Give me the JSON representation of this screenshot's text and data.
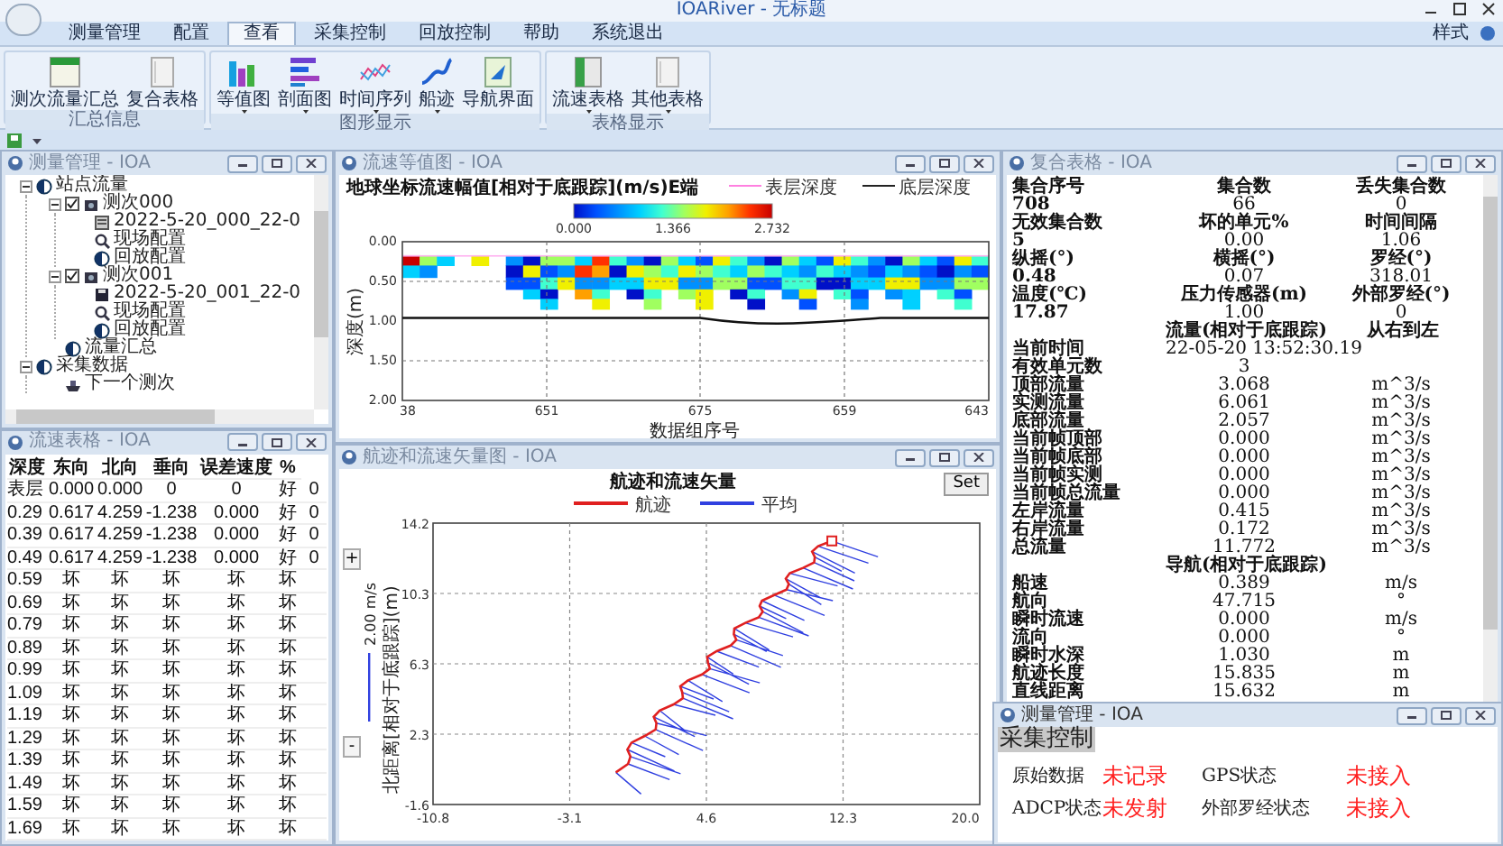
{
  "window": {
    "title": "IOARiver - 无标题"
  },
  "menu_tabs": [
    {
      "label": "测量管理",
      "selected": false
    },
    {
      "label": "配置",
      "selected": false
    },
    {
      "label": "查看",
      "selected": true
    },
    {
      "label": "采集控制",
      "selected": false
    },
    {
      "label": "回放控制",
      "selected": false
    },
    {
      "label": "帮助",
      "selected": false
    },
    {
      "label": "系统退出",
      "selected": false
    }
  ],
  "style_menu": "样式",
  "ribbon_groups": [
    {
      "label": "汇总信息",
      "buttons": [
        {
          "label": "测次流量汇总",
          "kind": "summary",
          "dropdown": false
        },
        {
          "label": "复合表格",
          "kind": "page",
          "dropdown": false
        }
      ]
    },
    {
      "label": "图形显示",
      "buttons": [
        {
          "label": "等值图",
          "kind": "bars",
          "dropdown": true
        },
        {
          "label": "剖面图",
          "kind": "hbars",
          "dropdown": true
        },
        {
          "label": "时间序列",
          "kind": "series",
          "dropdown": true
        },
        {
          "label": "船迹",
          "kind": "track",
          "dropdown": true
        },
        {
          "label": "导航界面",
          "kind": "nav",
          "dropdown": false
        }
      ]
    },
    {
      "label": "表格显示",
      "buttons": [
        {
          "label": "流速表格",
          "kind": "table",
          "dropdown": true
        },
        {
          "label": "其他表格",
          "kind": "page",
          "dropdown": true
        }
      ]
    }
  ],
  "tree_panel": {
    "title": "测量管理 - IOA",
    "nodes": [
      {
        "label": "站点流量",
        "kind": "site",
        "expanded": true,
        "children": [
          {
            "label": "测次000",
            "kind": "run",
            "checked": true,
            "expanded": true,
            "children": [
              {
                "label": "2022-5-20_000_22-0",
                "kind": "file"
              },
              {
                "label": "现场配置",
                "kind": "config"
              },
              {
                "label": "回放配置",
                "kind": "site"
              }
            ]
          },
          {
            "label": "测次001",
            "kind": "run",
            "checked": true,
            "expanded": true,
            "children": [
              {
                "label": "2022-5-20_001_22-0",
                "kind": "disk"
              },
              {
                "label": "现场配置",
                "kind": "config"
              },
              {
                "label": "回放配置",
                "kind": "site"
              }
            ]
          },
          {
            "label": "流量汇总",
            "kind": "site"
          }
        ]
      },
      {
        "label": "采集数据",
        "kind": "site",
        "expanded": true,
        "children": [
          {
            "label": "下一个测次",
            "kind": "boat"
          }
        ]
      }
    ]
  },
  "contour_panel": {
    "title": "流速等值图 - IOA",
    "chart_title": "地球坐标流速幅值[相对于底跟踪](m/s)E端",
    "legend": [
      "表层深度",
      "底层深度"
    ],
    "colorbar_labels": [
      "0.000",
      "1.366",
      "2.732"
    ],
    "yticks": [
      "0.00",
      "0.50",
      "1.00",
      "1.50",
      "2.00"
    ],
    "ylabel": "深度(m)",
    "xticks": [
      "38",
      "651",
      "675",
      "659",
      "643"
    ],
    "xlabel": "数据组序号"
  },
  "composite_panel": {
    "title": "复合表格 - IOA",
    "rows": [
      {
        "kind": "label",
        "name": "集合序号",
        "value": "集合数",
        "unit": "丢失集合数"
      },
      {
        "kind": "value",
        "name": "708",
        "value": "66",
        "unit": "0"
      },
      {
        "kind": "label",
        "name": "无效集合数",
        "value": "坏的单元%",
        "unit": "时间间隔"
      },
      {
        "kind": "value",
        "name": "5",
        "value": "0.00",
        "unit": "1.06"
      },
      {
        "kind": "label",
        "name": "纵摇(°)",
        "value": "横摇(°)",
        "unit": "罗经(°)"
      },
      {
        "kind": "value",
        "name": "0.48",
        "value": "0.07",
        "unit": "318.01"
      },
      {
        "kind": "label",
        "name": "温度(℃)",
        "value": "压力传感器(m)",
        "unit": "外部罗经(°)"
      },
      {
        "kind": "value",
        "name": "17.87",
        "value": "1.00",
        "unit": "0"
      },
      {
        "kind": "label",
        "value": "流量(相对于底跟踪)",
        "unit": "从右到左"
      },
      {
        "kind": "value",
        "name": "当前时间",
        "value": "22-05-20 13:52:30.19"
      },
      {
        "kind": "value",
        "name": "有效单元数",
        "value": "3"
      },
      {
        "kind": "value",
        "name": "顶部流量",
        "value": "3.068",
        "unit": "m^3/s"
      },
      {
        "kind": "value",
        "name": "实测流量",
        "value": "6.061",
        "unit": "m^3/s"
      },
      {
        "kind": "value",
        "name": "底部流量",
        "value": "2.057",
        "unit": "m^3/s"
      },
      {
        "kind": "value",
        "name": "当前帧顶部",
        "value": "0.000",
        "unit": "m^3/s"
      },
      {
        "kind": "value",
        "name": "当前帧底部",
        "value": "0.000",
        "unit": "m^3/s"
      },
      {
        "kind": "value",
        "name": "当前帧实测",
        "value": "0.000",
        "unit": "m^3/s"
      },
      {
        "kind": "value",
        "name": "当前帧总流量",
        "value": "0.000",
        "unit": "m^3/s"
      },
      {
        "kind": "value",
        "name": "左岸流量",
        "value": "0.415",
        "unit": "m^3/s"
      },
      {
        "kind": "value",
        "name": "右岸流量",
        "value": "0.172",
        "unit": "m^3/s"
      },
      {
        "kind": "value",
        "name": "总流量",
        "value": "11.772",
        "unit": "m^3/s"
      },
      {
        "kind": "label",
        "value": "导航(相对于底跟踪)"
      },
      {
        "kind": "value",
        "name": "船速",
        "value": "0.389",
        "unit": "m/s"
      },
      {
        "kind": "value",
        "name": "航向",
        "value": "47.715",
        "unit": "°"
      },
      {
        "kind": "value",
        "name": "瞬时流速",
        "value": "0.000",
        "unit": "m/s"
      },
      {
        "kind": "value",
        "name": "流向",
        "value": "0.000",
        "unit": "°"
      },
      {
        "kind": "value",
        "name": "瞬时水深",
        "value": "1.030",
        "unit": "m"
      },
      {
        "kind": "value",
        "name": "航迹长度",
        "value": "15.835",
        "unit": "m"
      },
      {
        "kind": "value",
        "name": "直线距离",
        "value": "15.632",
        "unit": "m"
      }
    ]
  },
  "velocity_panel": {
    "title": "流速表格 - IOA",
    "columns": [
      "深度",
      "东向",
      "北向",
      "垂向",
      "误差速度",
      "%"
    ],
    "rows": [
      [
        "表层",
        "0.000",
        "0.000",
        "0",
        "0",
        "好",
        "0"
      ],
      [
        "0.29",
        "0.617",
        "4.259",
        "-1.238",
        "0.000",
        "好",
        "0"
      ],
      [
        "0.39",
        "0.617",
        "4.259",
        "-1.238",
        "0.000",
        "好",
        "0"
      ],
      [
        "0.49",
        "0.617",
        "4.259",
        "-1.238",
        "0.000",
        "好",
        "0"
      ],
      [
        "0.59",
        "坏",
        "坏",
        "坏",
        "坏",
        "坏"
      ],
      [
        "0.69",
        "坏",
        "坏",
        "坏",
        "坏",
        "坏"
      ],
      [
        "0.79",
        "坏",
        "坏",
        "坏",
        "坏",
        "坏"
      ],
      [
        "0.89",
        "坏",
        "坏",
        "坏",
        "坏",
        "坏"
      ],
      [
        "0.99",
        "坏",
        "坏",
        "坏",
        "坏",
        "坏"
      ],
      [
        "1.09",
        "坏",
        "坏",
        "坏",
        "坏",
        "坏"
      ],
      [
        "1.19",
        "坏",
        "坏",
        "坏",
        "坏",
        "坏"
      ],
      [
        "1.29",
        "坏",
        "坏",
        "坏",
        "坏",
        "坏"
      ],
      [
        "1.39",
        "坏",
        "坏",
        "坏",
        "坏",
        "坏"
      ],
      [
        "1.49",
        "坏",
        "坏",
        "坏",
        "坏",
        "坏"
      ],
      [
        "1.59",
        "坏",
        "坏",
        "坏",
        "坏",
        "坏"
      ],
      [
        "1.69",
        "坏",
        "坏",
        "坏",
        "坏",
        "坏"
      ]
    ]
  },
  "track_panel": {
    "title": "航迹和流速矢量图 - IOA",
    "chart_title": "航迹和流速矢量",
    "legend": [
      {
        "label": "航迹",
        "color": "#e02020"
      },
      {
        "label": "平均",
        "color": "#3040e0"
      }
    ],
    "set_button": "Set",
    "zoom_in": "+",
    "zoom_out": "-",
    "scale_label": "2.00 m/s",
    "ylabel": "北距离[相对于底跟踪](m)",
    "yticks": [
      "14.2",
      "10.3",
      "6.3",
      "2.3",
      "-1.6"
    ],
    "xticks": [
      "-10.8",
      "-3.1",
      "4.6",
      "12.3",
      "20.0"
    ]
  },
  "control_dialog": {
    "title": "测量管理 - IOA",
    "heading": "采集控制",
    "items": [
      {
        "label": "原始数据",
        "status": "未记录"
      },
      {
        "label": "GPS状态",
        "status": "未接入"
      },
      {
        "label": "ADCP状态",
        "status": "未发射"
      },
      {
        "label": "外部罗经状态",
        "status": "未接入"
      }
    ]
  }
}
